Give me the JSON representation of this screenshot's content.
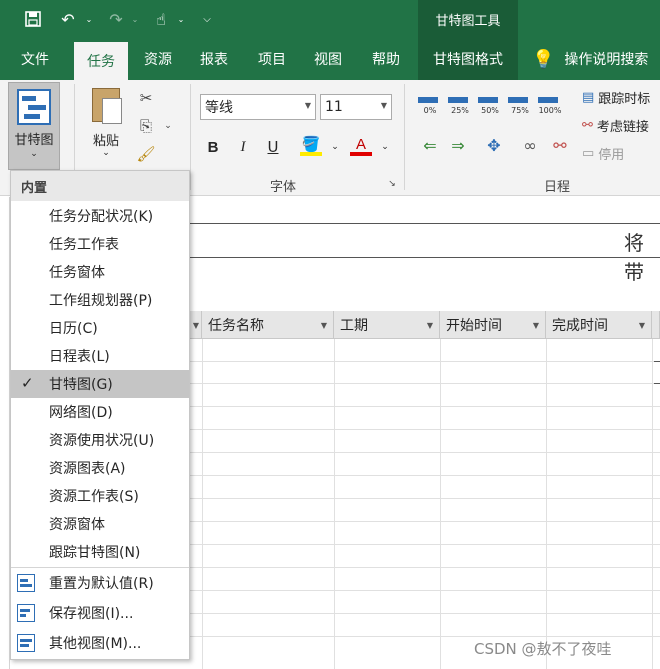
{
  "qat": {
    "save_icon": "save-icon",
    "undo_icon": "undo-icon",
    "redo_icon": "redo-icon",
    "touch_icon": "touch-mode-icon",
    "customize_icon": "customize-qat-icon"
  },
  "contextual_tool_header": "甘特图工具",
  "tabs": [
    {
      "label": "文件"
    },
    {
      "label": "任务"
    },
    {
      "label": "资源"
    },
    {
      "label": "报表"
    },
    {
      "label": "项目"
    },
    {
      "label": "视图"
    },
    {
      "label": "帮助"
    },
    {
      "label": "甘特图格式"
    }
  ],
  "tell_me": "操作说明搜索",
  "ribbon": {
    "gantt_button": "甘特图",
    "paste_button": "粘贴",
    "font_name": "等线",
    "font_size": "11",
    "font_group_label": "字体",
    "schedule_group_label": "日程",
    "percent_buttons": [
      "0%",
      "25%",
      "50%",
      "75%",
      "100%"
    ],
    "track_label": "跟踪时标",
    "respect_links_label": "考虑链接",
    "inactivate_label": "停用",
    "bold": "B",
    "italic": "I",
    "underline": "U",
    "font_color": "A"
  },
  "timeline_text": "将带",
  "columns": [
    {
      "label": "任务名称"
    },
    {
      "label": "工期"
    },
    {
      "label": "开始时间"
    },
    {
      "label": "完成时间"
    }
  ],
  "menu": {
    "header": "内置",
    "items": [
      {
        "label": "任务分配状况(K)"
      },
      {
        "label": "任务工作表"
      },
      {
        "label": "任务窗体"
      },
      {
        "label": "工作组规划器(P)"
      },
      {
        "label": "日历(C)"
      },
      {
        "label": "日程表(L)"
      },
      {
        "label": "甘特图(G)",
        "selected": true
      },
      {
        "label": "网络图(D)"
      },
      {
        "label": "资源使用状况(U)"
      },
      {
        "label": "资源图表(A)"
      },
      {
        "label": "资源工作表(S)"
      },
      {
        "label": "资源窗体"
      },
      {
        "label": "跟踪甘特图(N)"
      }
    ],
    "commands": [
      {
        "label": "重置为默认值(R)"
      },
      {
        "label": "保存视图(I)..."
      },
      {
        "label": "其他视图(M)..."
      }
    ]
  },
  "watermark": "CSDN @敖不了夜哇",
  "colors": {
    "accent": "#217346",
    "accent_dark": "#1a5c37",
    "blue": "#2e6eb5"
  }
}
